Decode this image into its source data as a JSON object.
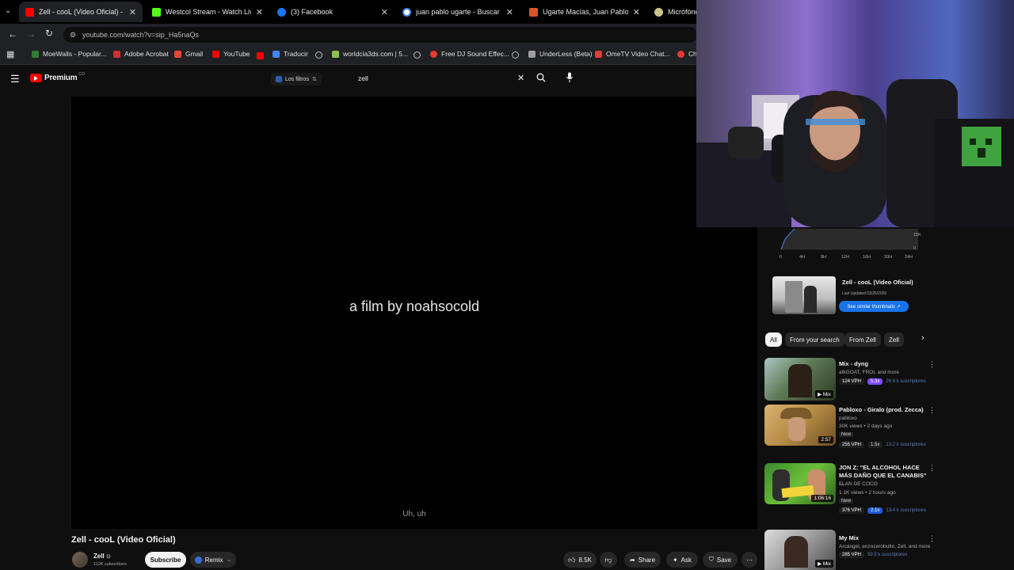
{
  "browser": {
    "tabs": [
      {
        "title": "Zell - cooL (Video Oficial) - You",
        "active": true,
        "color": "#ff0000"
      },
      {
        "title": "Westcol Stream - Watch Live on",
        "active": false,
        "color": "#53fc18"
      },
      {
        "title": "(3) Facebook",
        "active": false,
        "color": "#1877f2"
      },
      {
        "title": "juan pablo ugarte - Buscar con",
        "active": false,
        "color": "#4285f4"
      },
      {
        "title": "Ugarte Macías, Juan Pablo",
        "active": false,
        "color": "#d9542c"
      },
      {
        "title": "Micrófono",
        "active": false,
        "color": "#c9c38a"
      }
    ],
    "url": "youtube.com/watch?v=sip_Ha5naQs",
    "bookmarks": [
      {
        "label": "MoeWalls - Popular...",
        "color": "#2e7d32"
      },
      {
        "label": "Adobe Acrobat",
        "color": "#d32f2f"
      },
      {
        "label": "Gmail",
        "color": "#ea4335"
      },
      {
        "label": "YouTube",
        "color": "#ff0000"
      },
      {
        "label": "Traducir",
        "color": "#4285f4"
      },
      {
        "label": "worldcia3ds.com | 5...",
        "color": "#8bc34a"
      },
      {
        "label": "Free DJ Sound Effec...",
        "color": "#e53935"
      },
      {
        "label": "UnderLess (Beta)",
        "color": "#9e9e9e"
      },
      {
        "label": "OmeTV Video Chat...",
        "color": "#e53935"
      },
      {
        "label": "Ch",
        "color": "#e53935"
      }
    ]
  },
  "youtube": {
    "logo": "Premium",
    "logo_sup": "CO",
    "filters_label": "Los filtros",
    "search_value": "zell",
    "film_text": "a film by noahsocold",
    "subtitle": "Uh, uh",
    "video_title": "Zell - cooL (Video Oficial)",
    "channel": "Zell",
    "subscribers": "112K subscribers",
    "subscribe": "Subscribe",
    "remix": "Remix",
    "likes": "8.5K",
    "share": "Share",
    "ask": "Ask",
    "save": "Save"
  },
  "sidebar": {
    "graph": {
      "y_labels": [
        "15K",
        "0"
      ],
      "x_labels": [
        "0",
        "4H",
        "8H",
        "12H",
        "16H",
        "20H",
        "24H"
      ]
    },
    "card": {
      "title": "Zell - cooL (Video Oficial)",
      "updated": "Last Updated 03/25/2026",
      "button": "See similar thumbnails ↗"
    },
    "chips": [
      "All",
      "From your search",
      "From Zell",
      "Zell"
    ],
    "recs": [
      {
        "title": "Mix - dyng",
        "meta1": "afkGOAT, FROI, and more",
        "meta2": "",
        "badge": "",
        "overlay": "Mix",
        "vph": "124 VPH",
        "mult": "5.3x",
        "subs": "26.6 k suscriptores"
      },
      {
        "title": "Pabloxo - Giralo (prod. Zecca)",
        "meta1": "pabloxo",
        "meta2": "30K views • 2 days ago",
        "badge": "New",
        "overlay": "2:57",
        "vph": "255 VPH",
        "mult": "1.5x",
        "subs": "13.2 k suscriptores"
      },
      {
        "title": "JON Z: \"EL ALCOHOL HACE MÁS DAÑO QUE EL CANABIS\" ...",
        "meta1": "FLAN DE COCO",
        "meta2": "1.1K views • 2 hours ago",
        "badge": "New",
        "overlay": "1:06:16",
        "vph": "376 VPH",
        "mult": "2.1x",
        "subs": "13.4 k suscriptores"
      },
      {
        "title": "My Mix",
        "meta1": "Arcángel, enzocerobulto, Zell, and more",
        "meta2": "",
        "badge": "",
        "overlay": "Mix",
        "vph": "285 VPH",
        "mult": "",
        "subs": "59.9 k suscriptores"
      }
    ]
  },
  "colors": {
    "yt_red": "#ff0000",
    "accent_blue": "#3ea6ff",
    "vph_green": "#2ecc71",
    "mult_purple": "#7c4dff",
    "webcam_purple": "#7b5bb8"
  }
}
